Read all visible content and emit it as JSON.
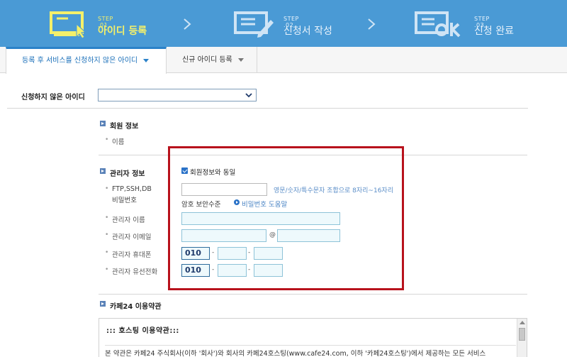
{
  "steps": [
    {
      "label": "STEP .01",
      "name": "아이디 등록",
      "icon": "monitor-pointer-icon"
    },
    {
      "label": "STEP .02",
      "name": "신청서 작성",
      "icon": "document-pen-icon"
    },
    {
      "label": "STEP .03",
      "name": "신청 완료",
      "icon": "ok-icon"
    }
  ],
  "tabs": [
    {
      "label": "등록 후 서비스를 신청하지 않은 아이디",
      "active": true
    },
    {
      "label": "신규 아이디 등록",
      "active": false
    }
  ],
  "select_row": {
    "label": "신청하지 않은 아이디",
    "value": ""
  },
  "member_info": {
    "title": "회원 정보",
    "name_label": "이름"
  },
  "admin_info": {
    "title": "관리자 정보",
    "same_as_member": "회원정보와 동일",
    "ftp_label_1": "FTP,SSH,DB",
    "ftp_label_2": "비밀번호",
    "ftp_hint": "영문/숫자/특수문자 조합으로 8자리~16자리",
    "pw_level_label": "암호 보안수준",
    "pw_help": "비밀번호 도움말",
    "name_label": "관리자 이름",
    "email_label": "관리자 이메일",
    "email_at": "@",
    "mobile_label": "관리자 휴대폰",
    "mobile_prefix": "010",
    "phone_label": "관리자 유선전화",
    "phone_prefix": "010",
    "dash": "-"
  },
  "terms": {
    "title": "카페24 이용약관",
    "heading": "::: 호스팅 이용약관:::",
    "body": "본 약관은 카페24 주식회사(이하 '회사')와 회사의 카페24호스팅(www.cafe24.com, 이하 '카페24호스팅')에서 제공하는 모든 서비스"
  },
  "colors": {
    "header_bg": "#4a9ad5",
    "active_step": "#f4f06a",
    "accent": "#2b82c9",
    "highlight_border": "#b8121c"
  }
}
